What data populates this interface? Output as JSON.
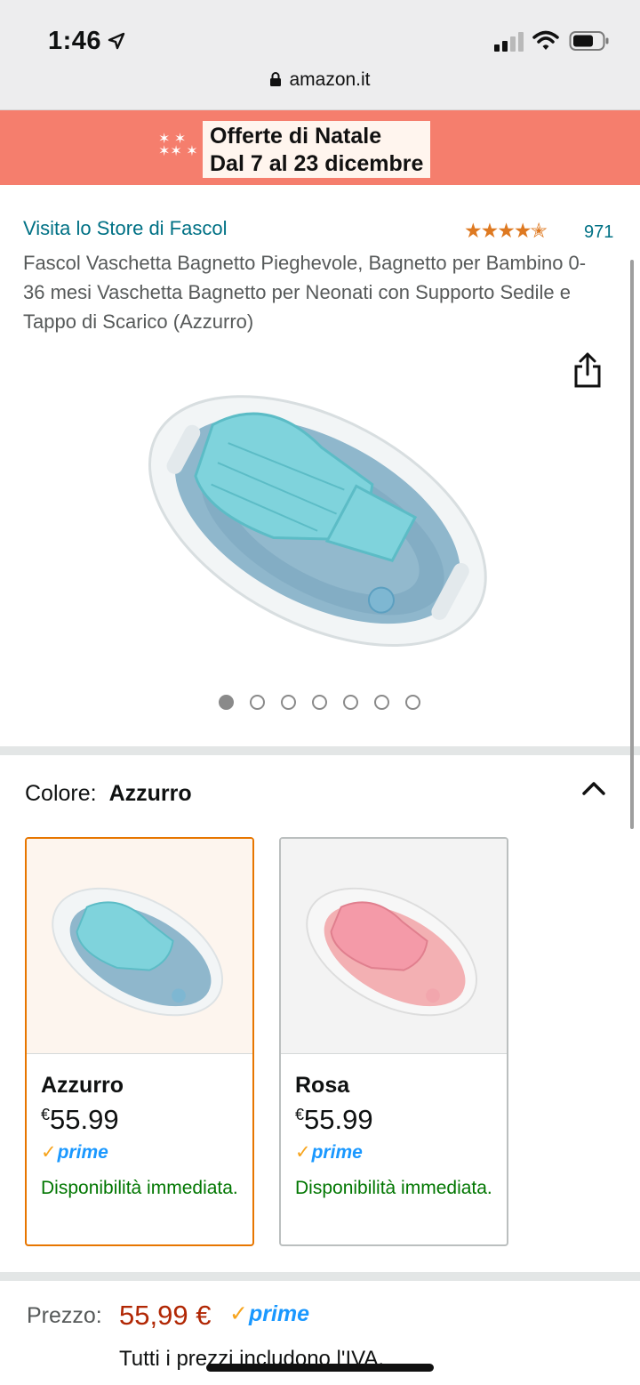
{
  "status_bar": {
    "time": "1:46"
  },
  "browser": {
    "url": "amazon.it"
  },
  "banner": {
    "line1": "Offerte di Natale",
    "line2": "Dal 7 al 23 dicembre"
  },
  "product": {
    "store_link": "Visita lo Store di Fascol",
    "rating_stars": "★★★★✭",
    "rating_value": 4.5,
    "rating_count": "971",
    "title": "Fascol Vaschetta Bagnetto Pieghevole, Bagnetto per Bambino 0-36 mesi Vaschetta Bagnetto per Neonati con Supporto Sedile e Tappo di Scarico (Azzurro)",
    "image_count": 7,
    "active_image": 1
  },
  "color_selector": {
    "label": "Colore:",
    "selected": "Azzurro",
    "options": [
      {
        "name": "Azzurro",
        "currency": "€",
        "price": "55.99",
        "prime": "prime",
        "availability": "Disponibilità immediata.",
        "accent": "#7fd1d6"
      },
      {
        "name": "Rosa",
        "currency": "€",
        "price": "55.99",
        "prime": "prime",
        "availability": "Disponibilità immediata.",
        "accent": "#f4a3ae"
      }
    ]
  },
  "price": {
    "label": "Prezzo:",
    "value": "55,99 €",
    "prime": "prime",
    "vat_note": "Tutti i prezzi includono l'IVA."
  },
  "colors": {
    "link": "#007185",
    "price": "#b12704",
    "available": "#007600",
    "prime": "#1a98ff",
    "selected_border": "#e77600"
  }
}
